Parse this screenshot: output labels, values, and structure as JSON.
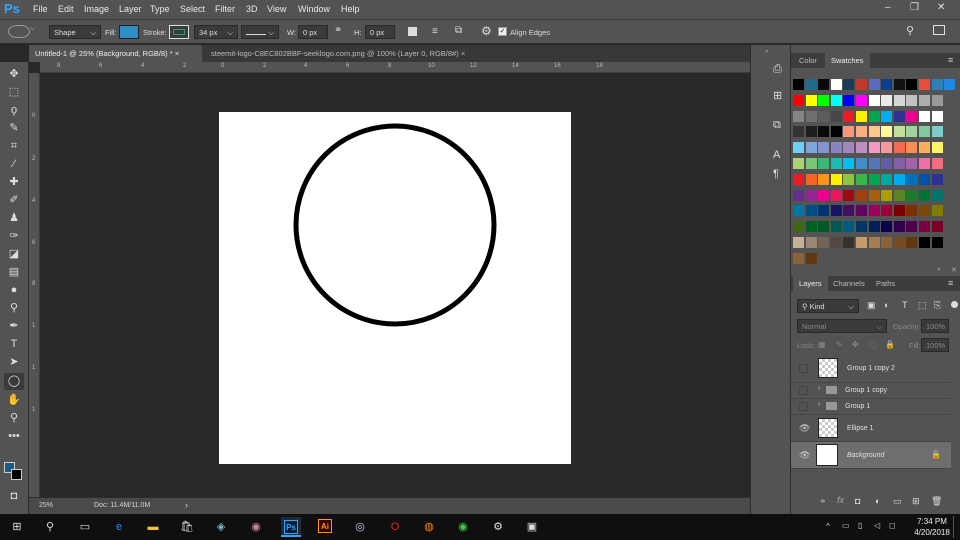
{
  "app": {
    "logo": "Ps"
  },
  "menu": [
    "File",
    "Edit",
    "Image",
    "Layer",
    "Type",
    "Select",
    "Filter",
    "3D",
    "View",
    "Window",
    "Help"
  ],
  "window_controls": [
    "–",
    "❐",
    "✕"
  ],
  "options": {
    "shape_mode": "Shape",
    "fill_label": "Fill:",
    "fill_color": "#2f8ec8",
    "stroke_label": "Stroke:",
    "stroke_color": "#2aa06a",
    "stroke_width": "34 px",
    "w_label": "W:",
    "w_value": "0 px",
    "h_label": "H:",
    "h_value": "0 px",
    "align_edges": "Align Edges"
  },
  "tabs": [
    {
      "label": "Untitled-1 @ 25% (Background, RGB/8) *",
      "close": "×"
    },
    {
      "label": "steemit-logo-C8EC802BBF-seeklogo.com.png @ 100% (Layer 0, RGB/8#)",
      "close": "×"
    }
  ],
  "ruler_top": [
    "8",
    "6",
    "4",
    "2",
    "0",
    "2",
    "4",
    "6",
    "8",
    "10",
    "12",
    "14",
    "16",
    "18"
  ],
  "ruler_left": [
    "0",
    "2",
    "4",
    "6",
    "8",
    "1",
    "1",
    "1"
  ],
  "status": {
    "zoom": "25%",
    "doc": "Doc: 11.4M/11.0M",
    "arrow": "›"
  },
  "swatches_panel": {
    "tabs": [
      "Color",
      "Swatches"
    ],
    "active": "Swatches",
    "rows": [
      [
        "#000000",
        "#1e6b8e",
        "#0a0a0a",
        "#ffffff",
        "#1a3a5a",
        "#c0392b",
        "#5c6bc0",
        "#0b3d91",
        "#111111",
        "#000000",
        "#e74c3c",
        "#2e7fb8",
        "#1e88e5"
      ],
      [
        "#ff0000",
        "#ffff00",
        "#00ff00",
        "#00ffff",
        "#0000ff",
        "#ff00ff",
        "#ffffff",
        "#ebebeb",
        "#d6d6d6",
        "#c2c2c2",
        "#adadad",
        "#999999"
      ],
      [
        "#858585",
        "#707070",
        "#5c5c5c",
        "#474747",
        "#ed1c24",
        "#fff200",
        "#00a651",
        "#00aeef",
        "#2e3192",
        "#ec008c",
        "#ffffff",
        "#ffffff"
      ],
      [
        "#333333",
        "#1f1f1f",
        "#0a0a0a",
        "#000000",
        "#f7977a",
        "#f9ad81",
        "#fdc68a",
        "#fff79a",
        "#c4df9b",
        "#a3d39c",
        "#82ca9d",
        "#7bcdc8"
      ],
      [
        "#6ecff6",
        "#7ea7d8",
        "#8493ca",
        "#8882be",
        "#a187be",
        "#bc8dbf",
        "#f49ac2",
        "#f6989d",
        "#f26c4f",
        "#f68e55",
        "#fbaf5c",
        "#fff467"
      ],
      [
        "#acd372",
        "#7cc576",
        "#3bb878",
        "#1abbb4",
        "#00bff3",
        "#438ccb",
        "#5574b9",
        "#605ca8",
        "#855fa8",
        "#a763a8",
        "#f06eaa",
        "#f26d7d"
      ],
      [
        "#ed1c24",
        "#f26522",
        "#f7941d",
        "#fff200",
        "#8dc73f",
        "#39b54a",
        "#00a651",
        "#00a99d",
        "#00aeef",
        "#0072bc",
        "#0054a6",
        "#2e3192"
      ],
      [
        "#662d91",
        "#92278f",
        "#ec008c",
        "#ed145b",
        "#9e0b0f",
        "#a0410d",
        "#a36209",
        "#aba000",
        "#598527",
        "#1a7b30",
        "#007236",
        "#00746b"
      ],
      [
        "#0076a3",
        "#004b80",
        "#003471",
        "#1b1464",
        "#440e62",
        "#630460",
        "#9e005d",
        "#9e0039",
        "#790000",
        "#7b2e00",
        "#7d4900",
        "#827b00"
      ],
      [
        "#406618",
        "#005e20",
        "#005826",
        "#005952",
        "#005b7f",
        "#003663",
        "#002157",
        "#0d004c",
        "#32004b",
        "#4b0049",
        "#7b0046",
        "#7a0026"
      ],
      [
        "#c7b299",
        "#998675",
        "#736357",
        "#534741",
        "#37302d",
        "#c69c6d",
        "#a67c52",
        "#8c6239",
        "#754c24",
        "#603913",
        "#000000",
        "#000000"
      ],
      [
        "#8c6239",
        "#603913"
      ]
    ]
  },
  "layers_panel": {
    "tabs": [
      "Layers",
      "Channels",
      "Paths"
    ],
    "active": "Layers",
    "filter": "Kind",
    "blend": "Normal",
    "opacity_label": "Opacity:",
    "opacity": "100%",
    "lock_label": "Lock:",
    "fill_label": "Fill:",
    "fill": "100%",
    "layers": [
      {
        "name": "Group 1 copy 2",
        "visible": false,
        "kind": "shape"
      },
      {
        "name": "Group 1 copy",
        "visible": false,
        "kind": "group"
      },
      {
        "name": "Group 1",
        "visible": false,
        "kind": "group"
      },
      {
        "name": "Ellipse 1",
        "visible": true,
        "kind": "shape"
      },
      {
        "name": "Background",
        "visible": true,
        "kind": "background"
      }
    ]
  },
  "taskbar": {
    "time": "7:34 PM",
    "date": "4/20/2018"
  }
}
